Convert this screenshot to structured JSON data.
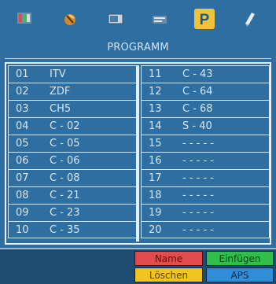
{
  "title": "PROGRAMM",
  "icons": [
    {
      "name": "picture-settings-icon"
    },
    {
      "name": "sound-settings-icon"
    },
    {
      "name": "screen-mode-icon"
    },
    {
      "name": "teletext-icon"
    },
    {
      "name": "program-icon",
      "selected": true
    },
    {
      "name": "setup-icon"
    }
  ],
  "channels": {
    "left": [
      {
        "num": "01",
        "name": "ITV"
      },
      {
        "num": "02",
        "name": "ZDF"
      },
      {
        "num": "03",
        "name": "CH5"
      },
      {
        "num": "04",
        "name": "C - 02"
      },
      {
        "num": "05",
        "name": "C - 05"
      },
      {
        "num": "06",
        "name": "C - 06"
      },
      {
        "num": "07",
        "name": "C - 08"
      },
      {
        "num": "08",
        "name": "C - 21"
      },
      {
        "num": "09",
        "name": "C - 23"
      },
      {
        "num": "10",
        "name": "C - 35"
      }
    ],
    "right": [
      {
        "num": "11",
        "name": "C - 43"
      },
      {
        "num": "12",
        "name": "C - 64"
      },
      {
        "num": "13",
        "name": "C - 68"
      },
      {
        "num": "14",
        "name": "S - 40"
      },
      {
        "num": "15",
        "name": "- - - - -"
      },
      {
        "num": "16",
        "name": "- - - - -"
      },
      {
        "num": "17",
        "name": "- - - - -"
      },
      {
        "num": "18",
        "name": "- - - - -"
      },
      {
        "num": "19",
        "name": "- - - - -"
      },
      {
        "num": "20",
        "name": "- - - - -"
      }
    ]
  },
  "buttons": {
    "name": "Name",
    "insert": "Einfügen",
    "delete": "Löschen",
    "aps": "APS"
  },
  "colors": {
    "background": "#2f6ea1",
    "selected_icon": "#f0c43a",
    "red": "#e34c4c",
    "green": "#2fbf4a",
    "yellow": "#f1c51f",
    "blue": "#2f8ed6"
  }
}
